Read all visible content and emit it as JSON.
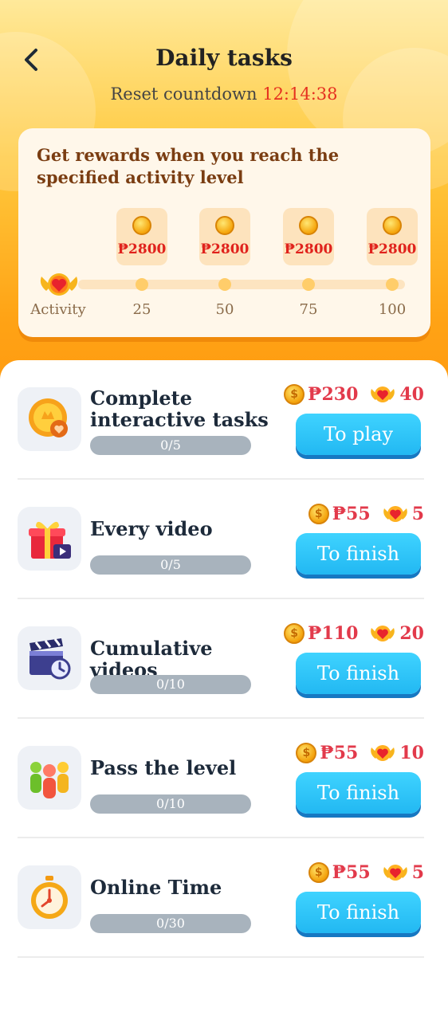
{
  "header": {
    "title": "Daily tasks",
    "countdown_label": "Reset countdown",
    "countdown_time": "12:14:38"
  },
  "rewards_card": {
    "description": "Get rewards when you reach the specified activity level",
    "chests": [
      {
        "amount": "₱2800"
      },
      {
        "amount": "₱2800"
      },
      {
        "amount": "₱2800"
      },
      {
        "amount": "₱2800"
      }
    ],
    "activity_label": "Activity",
    "levels": [
      "25",
      "50",
      "75",
      "100"
    ],
    "current_activity": 0
  },
  "tasks": [
    {
      "name": "Complete interactive tasks",
      "progress": "0/5",
      "coin_reward": "₱230",
      "activity_reward": "40",
      "button": "To play",
      "icon": "medal-coin-icon"
    },
    {
      "name": "Every video",
      "progress": "0/5",
      "coin_reward": "₱55",
      "activity_reward": "5",
      "button": "To finish",
      "icon": "gift-box-icon"
    },
    {
      "name": "Cumulative videos",
      "progress": "0/10",
      "coin_reward": "₱110",
      "activity_reward": "20",
      "button": "To finish",
      "icon": "clapperboard-icon"
    },
    {
      "name": "Pass the level",
      "progress": "0/10",
      "coin_reward": "₱55",
      "activity_reward": "10",
      "button": "To finish",
      "icon": "people-icon"
    },
    {
      "name": "Online Time",
      "progress": "0/30",
      "coin_reward": "₱55",
      "activity_reward": "5",
      "button": "To finish",
      "icon": "stopwatch-icon"
    }
  ],
  "coin_symbol": "$",
  "colors": {
    "accent_red": "#e5301f",
    "button_blue": "#22b8f2",
    "bg_orange": "#ffa315"
  }
}
